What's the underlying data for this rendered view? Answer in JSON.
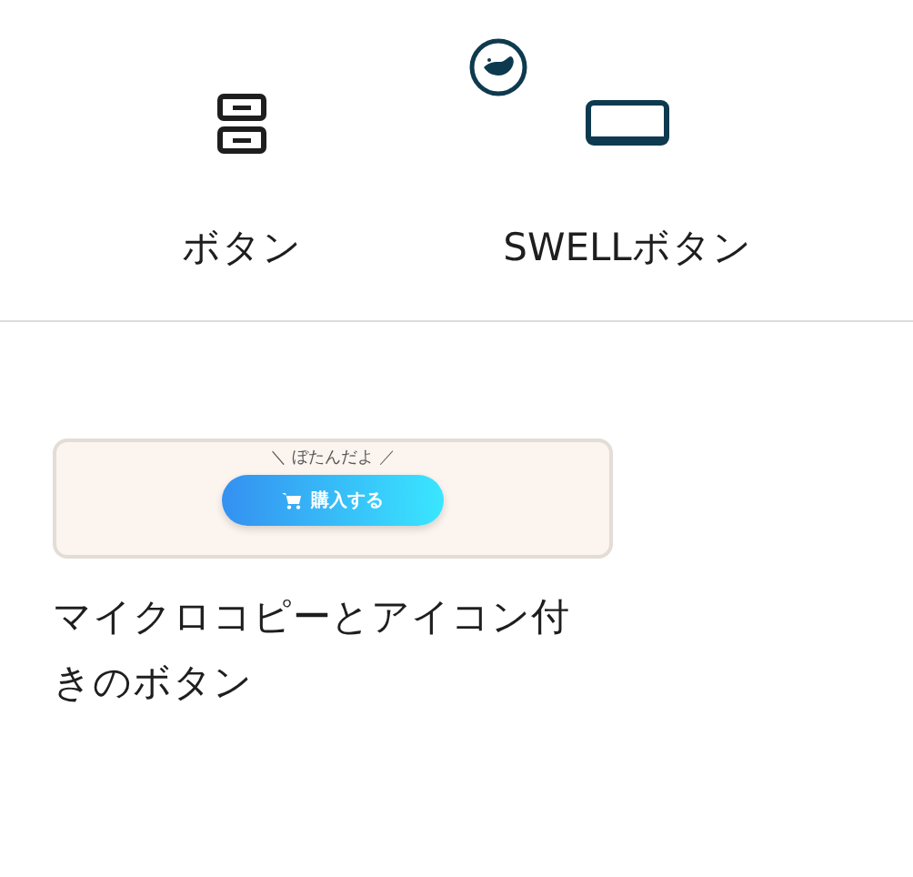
{
  "blocks": [
    {
      "kind": "button",
      "label": "ボタン",
      "badge": false
    },
    {
      "kind": "swell",
      "label": "SWELLボタン",
      "badge": true
    }
  ],
  "variation": {
    "microcopy": "＼ ぼたんだよ ／",
    "button_label": "購入する",
    "label": "マイクロコピーとアイコン付きのボタン"
  }
}
